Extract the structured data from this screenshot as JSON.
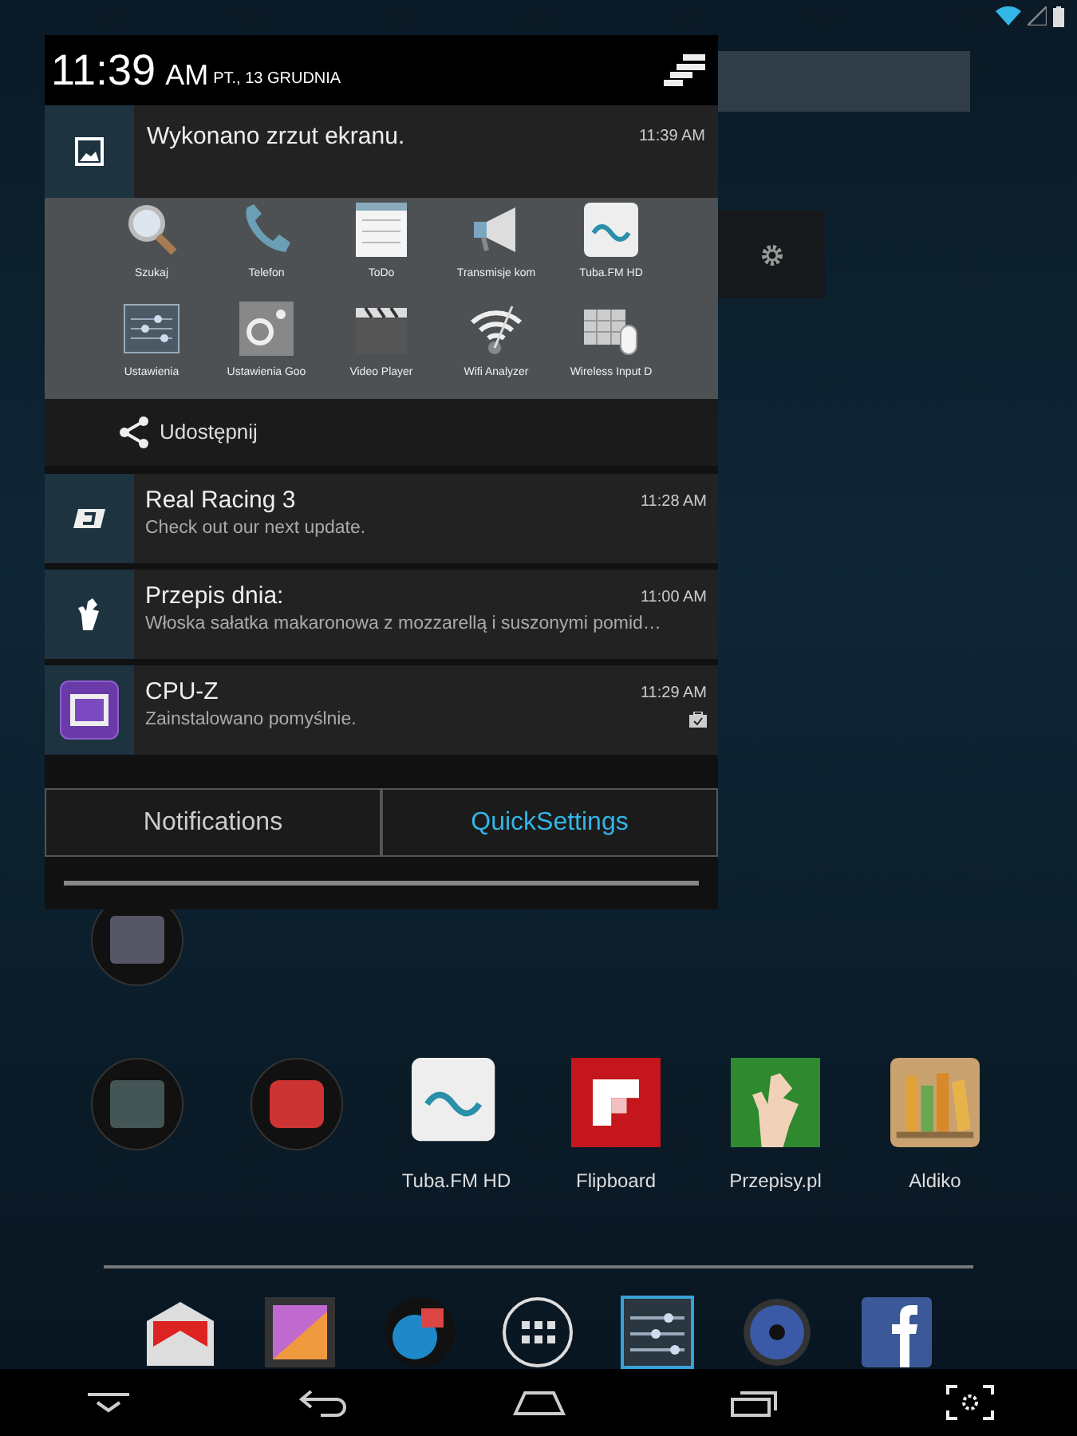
{
  "shade": {
    "time": "11:39",
    "ampm": "AM",
    "date": "PT., 13 GRUDNIA",
    "screenshot": {
      "title": "Wykonano zrzut ekranu.",
      "time": "11:39 AM",
      "share_apps": [
        {
          "label": "Szukaj"
        },
        {
          "label": "Telefon"
        },
        {
          "label": "ToDo"
        },
        {
          "label": "Transmisje kom"
        },
        {
          "label": "Tuba.FM HD"
        },
        {
          "label": "Ustawienia"
        },
        {
          "label": "Ustawienia Goo"
        },
        {
          "label": "Video Player"
        },
        {
          "label": "Wifi Analyzer"
        },
        {
          "label": "Wireless Input D"
        }
      ],
      "share_action": "Udostępnij"
    },
    "notifications": [
      {
        "title": "Real Racing 3",
        "text": "Check out our next update.",
        "time": "11:28 AM"
      },
      {
        "title": "Przepis dnia:",
        "text": "Włoska sałatka makaronowa z mozzarellą i suszonymi pomid…",
        "time": "11:00 AM"
      },
      {
        "title": "CPU-Z",
        "text": "Zainstalowano pomyślnie.",
        "time": "11:29 AM"
      }
    ],
    "tabs": [
      {
        "label": "Notifications",
        "selected": false
      },
      {
        "label": "QuickSettings",
        "selected": true
      }
    ]
  },
  "home": {
    "apps": [
      {
        "label": "Tuba.FM HD"
      },
      {
        "label": "Flipboard"
      },
      {
        "label": "Przepisy.pl"
      },
      {
        "label": "Aldiko"
      }
    ]
  }
}
